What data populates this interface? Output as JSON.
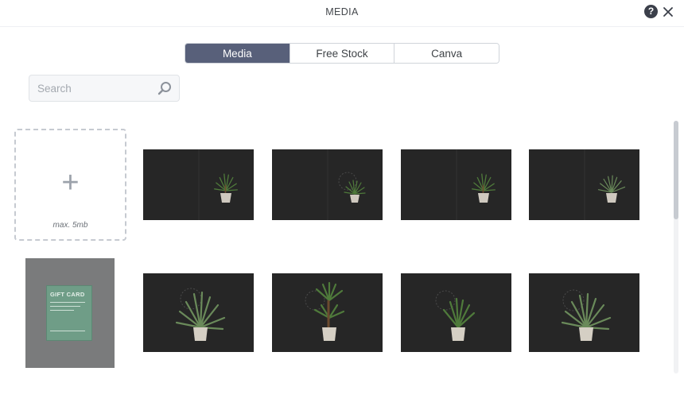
{
  "header": {
    "title": "MEDIA",
    "help_icon": "question-circle-icon",
    "help_glyph": "?",
    "close_icon": "close-icon"
  },
  "tabs": [
    {
      "label": "Media",
      "active": true
    },
    {
      "label": "Free Stock",
      "active": false
    },
    {
      "label": "Canva",
      "active": false
    }
  ],
  "search": {
    "placeholder": "Search",
    "value": "",
    "icon": "search-icon"
  },
  "upload": {
    "plus_glyph": "+",
    "hint": "max. 5mb"
  },
  "media_items": [
    {
      "type": "plant-photo"
    },
    {
      "type": "plant-photo"
    },
    {
      "type": "plant-photo"
    },
    {
      "type": "plant-photo"
    },
    {
      "type": "design-card",
      "card_title": "GIFT CARD"
    },
    {
      "type": "plant-photo"
    },
    {
      "type": "plant-photo"
    },
    {
      "type": "plant-photo"
    },
    {
      "type": "plant-photo"
    }
  ],
  "colors": {
    "active_tab": "#58607a",
    "thumb_background": "#262626",
    "card_background": "#6f9d87"
  }
}
